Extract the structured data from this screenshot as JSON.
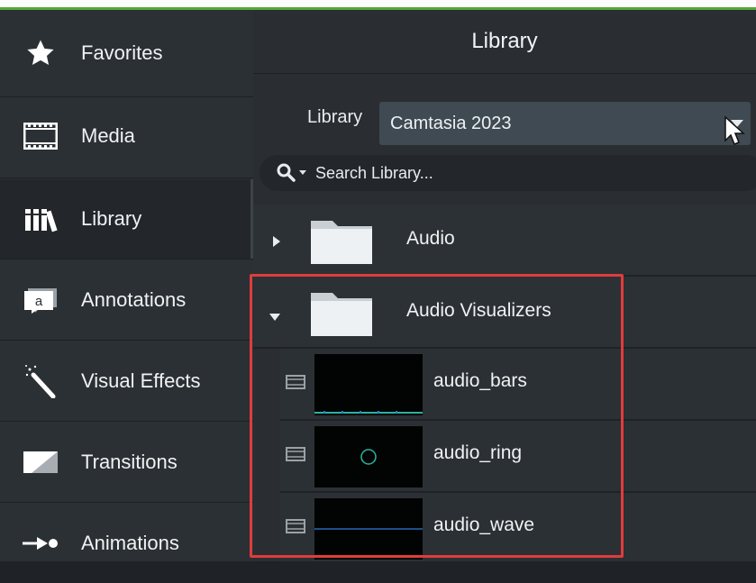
{
  "sidebar": {
    "items": [
      {
        "label": "Favorites",
        "icon": "star-icon"
      },
      {
        "label": "Media",
        "icon": "film-icon"
      },
      {
        "label": "Library",
        "icon": "library-books-icon",
        "active": true
      },
      {
        "label": "Annotations",
        "icon": "annotation-icon"
      },
      {
        "label": "Visual Effects",
        "icon": "magic-wand-icon"
      },
      {
        "label": "Transitions",
        "icon": "transition-icon"
      },
      {
        "label": "Animations",
        "icon": "animation-arrow-icon"
      }
    ]
  },
  "panel": {
    "title": "Library",
    "library_label": "Library",
    "library_select_value": "Camtasia 2023",
    "search_placeholder": "Search Library..."
  },
  "tree": {
    "folders": [
      {
        "name": "Audio",
        "expanded": false
      },
      {
        "name": "Audio Visualizers",
        "expanded": true
      }
    ],
    "assets": [
      {
        "name": "audio_bars",
        "thumb": "bars"
      },
      {
        "name": "audio_ring",
        "thumb": "ring"
      },
      {
        "name": "audio_wave",
        "thumb": "wave"
      }
    ]
  },
  "colors": {
    "accent_green": "#56a83a",
    "highlight_red": "#e03c3c",
    "thumb_cyan": "#2bb3a0"
  }
}
